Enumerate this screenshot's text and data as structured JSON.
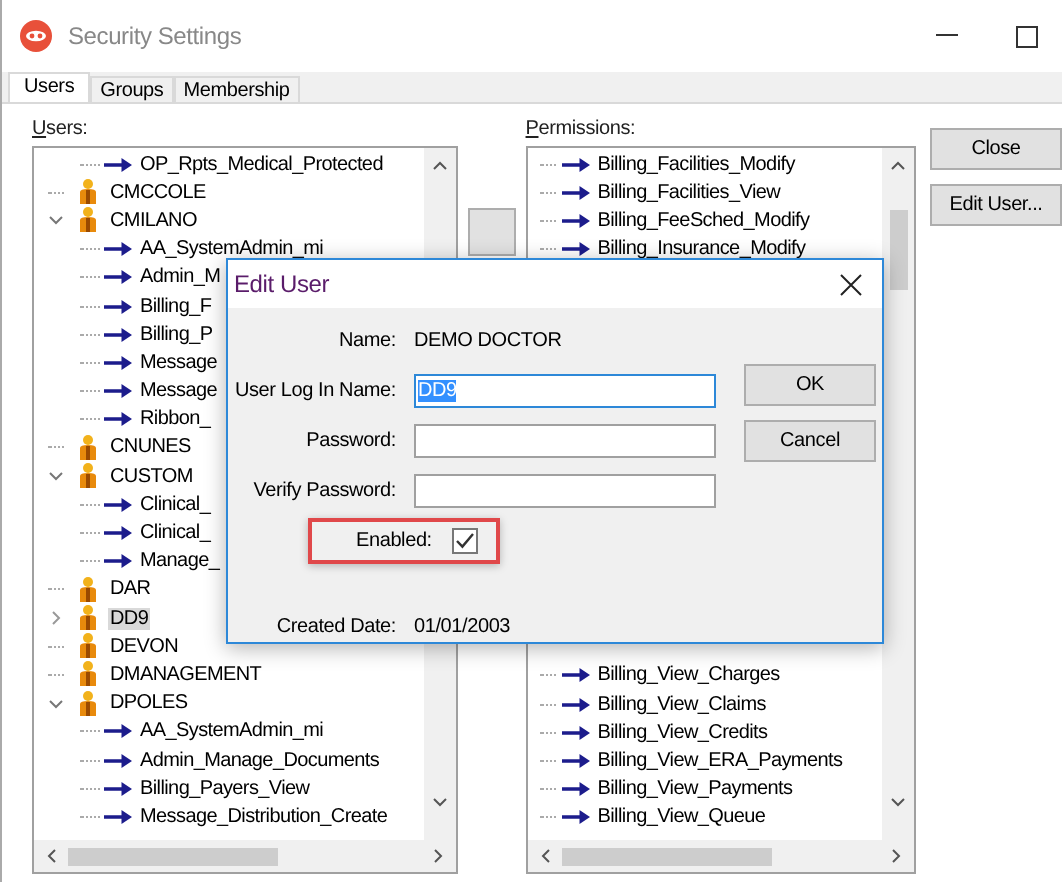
{
  "window": {
    "title": "Security Settings"
  },
  "tabs": [
    {
      "label": "Users",
      "selected": true
    },
    {
      "label": "Groups",
      "selected": false
    },
    {
      "label": "Membership",
      "selected": false
    }
  ],
  "users": {
    "label": "Users:",
    "items": [
      {
        "name": "OP_Rpts_Medical_Protected",
        "kind": "permission"
      },
      {
        "name": "CMCCOLE",
        "kind": "user",
        "selected": false
      },
      {
        "name": "CMILANO",
        "kind": "user",
        "selected": false,
        "expanded": true,
        "children": [
          {
            "name": "AA_SystemAdmin_mi"
          },
          {
            "name": "Admin_M"
          },
          {
            "name": "Billing_F"
          },
          {
            "name": "Billing_P"
          },
          {
            "name": "Message"
          },
          {
            "name": "Message"
          },
          {
            "name": "Ribbon_"
          }
        ]
      },
      {
        "name": "CNUNES",
        "kind": "user",
        "selected": false
      },
      {
        "name": "CUSTOM",
        "kind": "user",
        "selected": false,
        "expanded": true,
        "children": [
          {
            "name": "Clinical_"
          },
          {
            "name": "Clinical_"
          },
          {
            "name": "Manage_"
          }
        ]
      },
      {
        "name": "DAR",
        "kind": "user",
        "selected": false
      },
      {
        "name": "DD9",
        "kind": "user",
        "selected": true,
        "expanded": false
      },
      {
        "name": "DEVON",
        "kind": "user",
        "selected": false
      },
      {
        "name": "DMANAGEMENT",
        "kind": "user",
        "selected": false
      },
      {
        "name": "DPOLES",
        "kind": "user",
        "selected": false,
        "expanded": true,
        "children": [
          {
            "name": "AA_SystemAdmin_mi"
          },
          {
            "name": "Admin_Manage_Documents"
          },
          {
            "name": "Billing_Payers_View"
          },
          {
            "name": "Message_Distribution_Create"
          }
        ]
      }
    ]
  },
  "permissions": {
    "label": "Permissions:",
    "top_items": [
      "Billing_Facilities_Modify",
      "Billing_Facilities_View",
      "Billing_FeeSched_Modify",
      "Billing_Insurance_Modify"
    ],
    "bottom_items": [
      "Billing_View_Charges",
      "Billing_View_Claims",
      "Billing_View_Credits",
      "Billing_View_ERA_Payments",
      "Billing_View_Payments",
      "Billing_View_Queue"
    ]
  },
  "buttons": [
    "Close",
    "Edit User..."
  ],
  "dialog": {
    "title": "Edit User",
    "name_label": "Name:",
    "name_value": "DEMO DOCTOR",
    "fields": [
      {
        "label": "User Log In Name:",
        "value": "DD9",
        "focused": true
      },
      {
        "label": "Password:",
        "focused": false
      },
      {
        "label": "Verify Password:",
        "focused": false
      }
    ],
    "enabled": {
      "label": "Enabled:",
      "checked": true,
      "highlighted": true
    },
    "created_label": "Created Date:",
    "created_value": "01/01/2003",
    "buttons": [
      "OK",
      "Cancel"
    ]
  }
}
